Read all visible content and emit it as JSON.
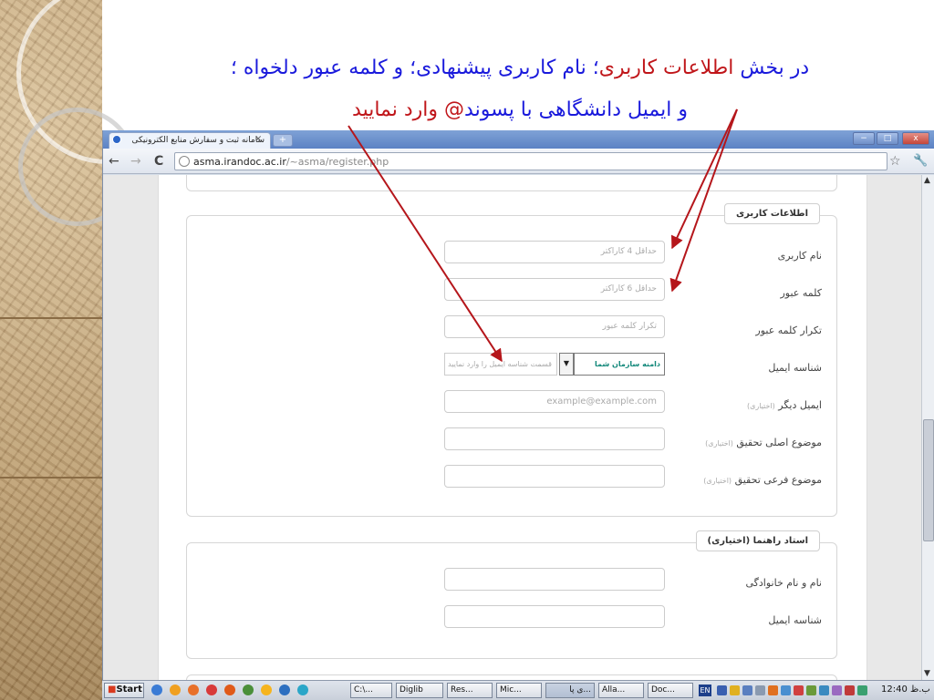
{
  "slide": {
    "caption_line1_part1": "در بخش ",
    "caption_line1_red": "اطلاعات کاربری",
    "caption_line1_part2": "؛ نام کاربری پیشنهادی؛ و کلمه عبور دلخواه  ؛",
    "caption_line2_part1": "و ایمیل دانشگاهی با پسوند",
    "caption_line2_red": "@ وارد نمایید",
    "arrow_color": "#b5161b"
  },
  "browser": {
    "tab_title": "سامانه ثبت و سفارش منابع الکترونیکی",
    "tab_close": "×",
    "new_tab": "+",
    "url_domain": "asma.irandoc.ac.ir",
    "url_path": "/~asma/register.php",
    "back": "←",
    "forward": "→",
    "reload": "C",
    "star": "☆",
    "wrench": "🔧",
    "min": "−",
    "max": "□",
    "close": "x"
  },
  "form": {
    "user_info": {
      "legend": "اطلاعات کاربری",
      "username_label": "نام کاربری",
      "username_placeholder": "حداقل 4 کاراکتر",
      "password_label": "کلمه عبور",
      "password_placeholder": "حداقل 6 کاراکتر",
      "confirm_label": "تکرار کلمه عبور",
      "confirm_placeholder": "تکرار کلمه عبور",
      "email_label": "شناسه ایمیل",
      "email_domain": "دامنه سازمان شما",
      "email_local_placeholder": "قسمت شناسه ایمیل را وارد نمایید",
      "other_email_label": "ایمیل دیگر",
      "optional": "(اختیاری)",
      "other_email_placeholder": "example@example.com",
      "main_topic_label": "موضوع اصلی تحقیق",
      "sub_topic_label": "موضوع فرعی تحقیق"
    },
    "advisor": {
      "legend": "استاد راهنما (اختیاری)",
      "name_label": "نام و نام خانوادگی",
      "email_label": "شناسه ایمیل"
    }
  },
  "taskbar": {
    "start": "Start",
    "tasks": [
      "C:\\...",
      "Diglib",
      "Res...",
      "Mic...",
      "...ی پا",
      "Alla...",
      "Doc..."
    ],
    "lang": "EN",
    "clock": "12:40 ب.ظ"
  },
  "colors": {
    "caption_blue": "#1a1adc",
    "caption_red": "#c0161a",
    "domain_teal": "#12887a"
  }
}
